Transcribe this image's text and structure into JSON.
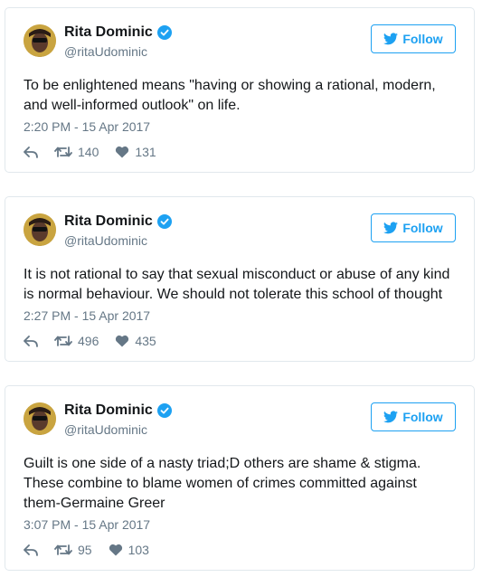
{
  "colors": {
    "accent": "#1da1f2",
    "muted": "#657786",
    "text": "#14171a",
    "border": "#e1e8ed"
  },
  "icons": {
    "reply": "reply-icon",
    "retweet": "retweet-icon",
    "like": "heart-icon",
    "verified": "verified-badge-icon",
    "bird": "twitter-bird-icon"
  },
  "tweets": [
    {
      "name": "Rita Dominic",
      "handle": "@ritaUdominic",
      "follow_label": "Follow",
      "text": "To be enlightened means \"having or showing a rational, modern, and well-informed outlook\" on life.",
      "time": "2:20 PM - 15 Apr 2017",
      "retweets": "140",
      "likes": "131"
    },
    {
      "name": "Rita Dominic",
      "handle": "@ritaUdominic",
      "follow_label": "Follow",
      "text": "It is not rational to say that sexual misconduct or abuse of any kind is normal behaviour. We should not tolerate this school of thought",
      "time": "2:27 PM - 15 Apr 2017",
      "retweets": "496",
      "likes": "435"
    },
    {
      "name": "Rita Dominic",
      "handle": "@ritaUdominic",
      "follow_label": "Follow",
      "text": "Guilt is one side of a nasty triad;D others are shame & stigma. These combine to blame women of crimes committed against them-Germaine Greer",
      "time": "3:07 PM - 15 Apr 2017",
      "retweets": "95",
      "likes": "103"
    }
  ]
}
